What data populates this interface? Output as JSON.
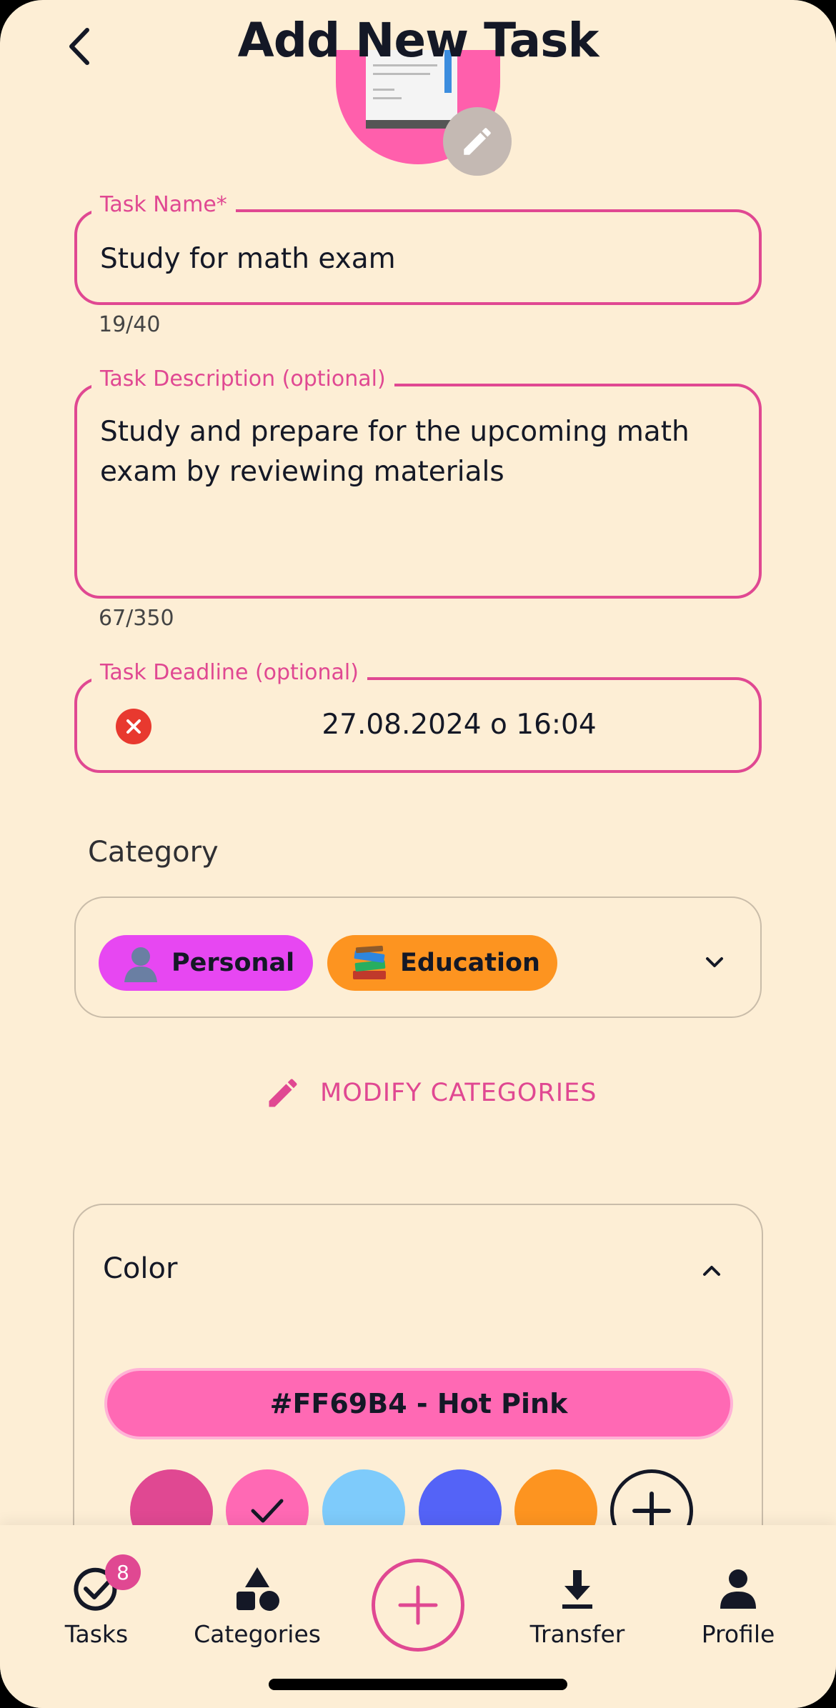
{
  "header": {
    "title": "Add New Task"
  },
  "task_name": {
    "label": "Task Name*",
    "value": "Study for math exam",
    "counter": "19/40"
  },
  "task_description": {
    "label": "Task Description (optional)",
    "value_line1": "Study and prepare for the upcoming math",
    "value_line2": "exam by reviewing materials",
    "counter": "67/350"
  },
  "task_deadline": {
    "label": "Task Deadline (optional)",
    "value": "27.08.2024 o 16:04"
  },
  "category": {
    "title": "Category",
    "chips": [
      {
        "label": "Personal",
        "emoji": "bust-silhouette",
        "color": "#e747f2"
      },
      {
        "label": "Education",
        "emoji": "books",
        "color": "#fd9420"
      }
    ],
    "modify_label": "MODIFY CATEGORIES"
  },
  "color": {
    "title": "Color",
    "selected_label": "#FF69B4 - Hot Pink",
    "swatches": [
      {
        "hex": "#e04892",
        "selected": false
      },
      {
        "hex": "#ff69b4",
        "selected": true
      },
      {
        "hex": "#7ecbfb",
        "selected": false
      },
      {
        "hex": "#5463f7",
        "selected": false
      },
      {
        "hex": "#fd9420",
        "selected": false
      }
    ]
  },
  "bottom_nav": {
    "tasks": "Tasks",
    "tasks_badge": "8",
    "categories": "Categories",
    "transfer": "Transfer",
    "profile": "Profile"
  },
  "theme": {
    "background": "#fdeed5",
    "accent": "#e04892",
    "text": "#141826"
  }
}
